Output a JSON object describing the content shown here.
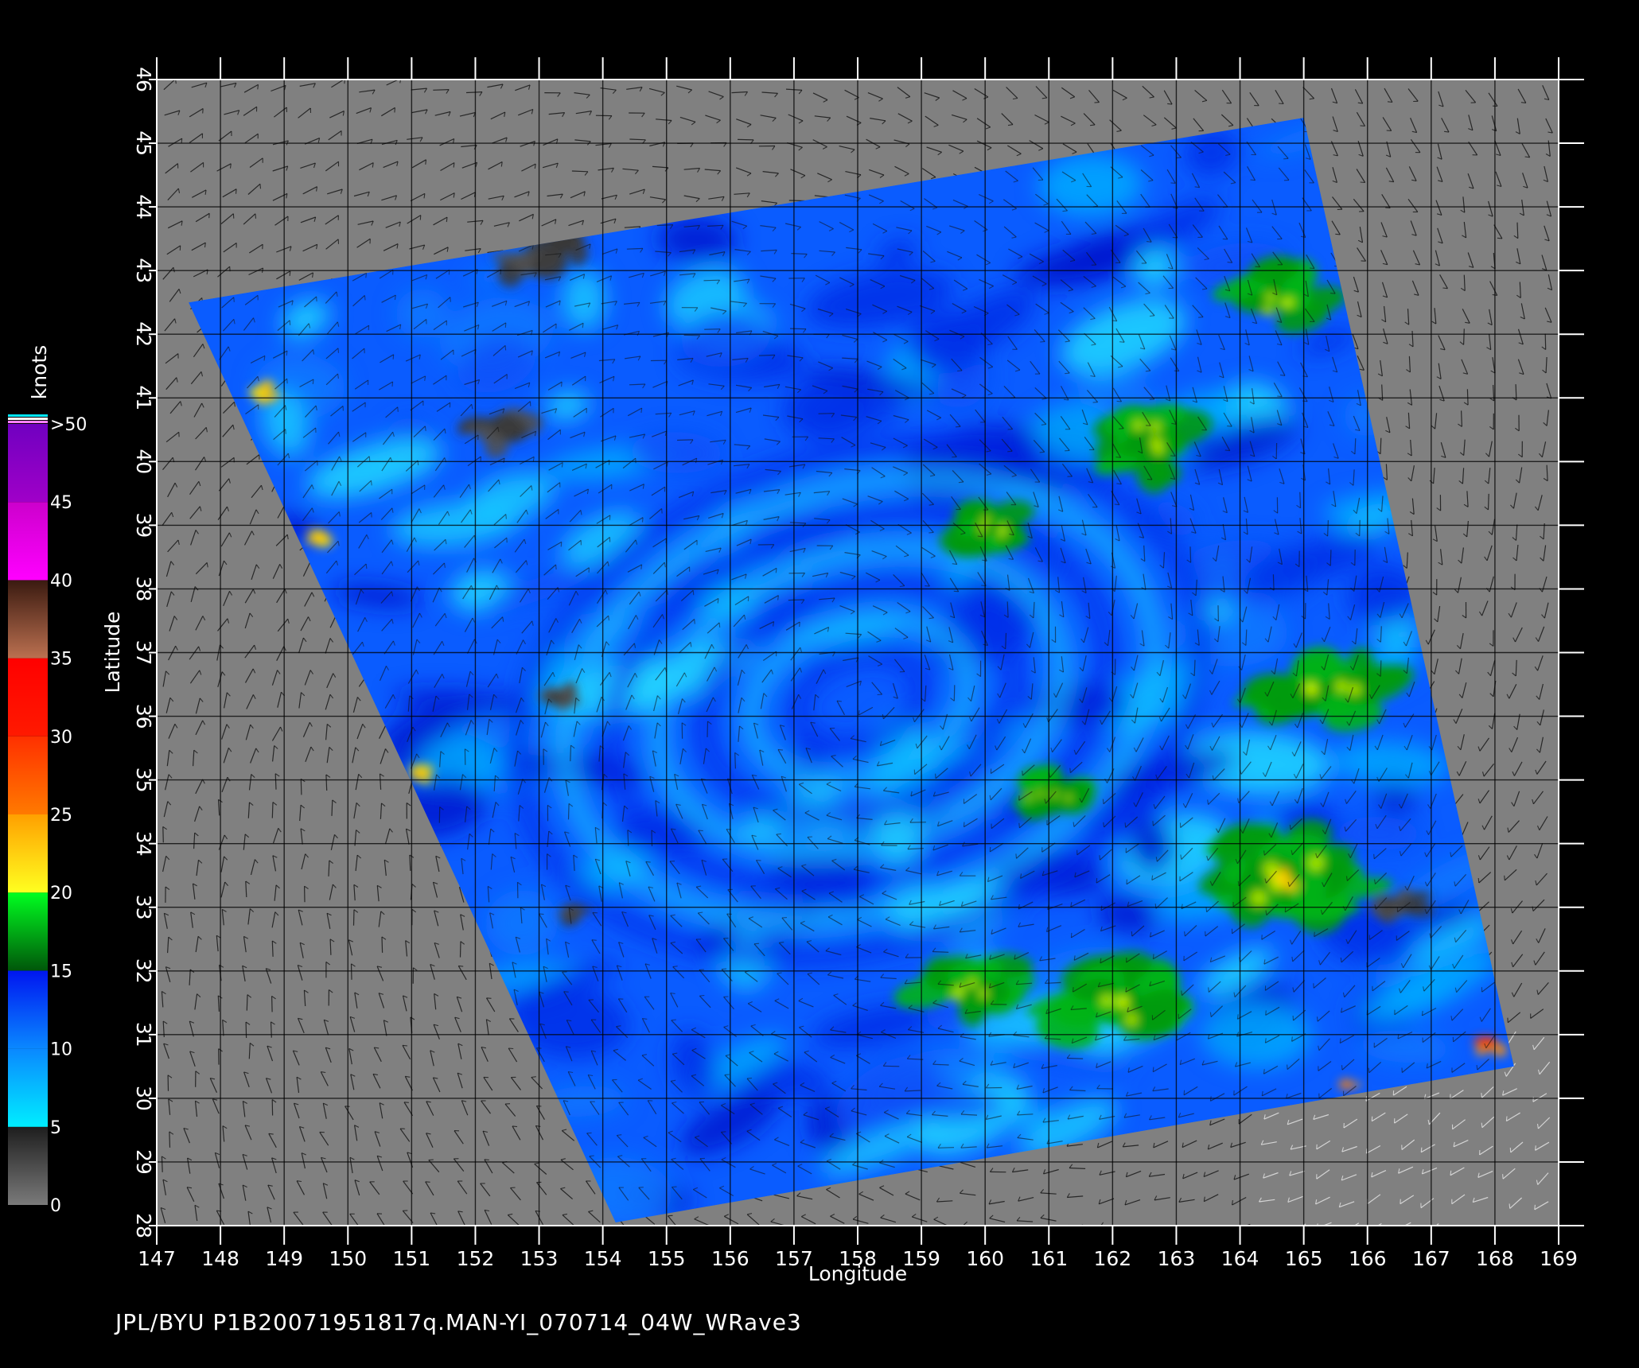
{
  "axes": {
    "xlabel": "Longitude",
    "ylabel": "Latitude",
    "lon_range": [
      147,
      169
    ],
    "lat_range": [
      28,
      46
    ],
    "lon_ticks": [
      "147",
      "148",
      "149",
      "150",
      "151",
      "152",
      "153",
      "154",
      "155",
      "156",
      "157",
      "158",
      "159",
      "160",
      "161",
      "162",
      "163",
      "164",
      "165",
      "166",
      "167",
      "168",
      "169"
    ],
    "lat_ticks": [
      "28",
      "29",
      "30",
      "31",
      "32",
      "33",
      "34",
      "35",
      "36",
      "37",
      "38",
      "39",
      "40",
      "41",
      "42",
      "43",
      "44",
      "45",
      "46"
    ],
    "grid": true
  },
  "colorbar": {
    "unit": "knots",
    "labels": [
      "0",
      "5",
      "10",
      "15",
      "20",
      "25",
      "30",
      "35",
      "40",
      "45",
      ">50"
    ],
    "bands": [
      {
        "from": 0,
        "to": 5,
        "colors": [
          "#7a7a7a",
          "#1e1e1e"
        ]
      },
      {
        "from": 5,
        "to": 10,
        "colors": [
          "#00eeff",
          "#0a88ff"
        ]
      },
      {
        "from": 10,
        "to": 15,
        "colors": [
          "#0a88ff",
          "#0016f0"
        ]
      },
      {
        "from": 15,
        "to": 20,
        "colors": [
          "#00560a",
          "#00ff20"
        ]
      },
      {
        "from": 20,
        "to": 25,
        "colors": [
          "#ffff20",
          "#ffa000"
        ]
      },
      {
        "from": 25,
        "to": 30,
        "colors": [
          "#ff7a00",
          "#ff3000"
        ]
      },
      {
        "from": 30,
        "to": 35,
        "colors": [
          "#ff1a00",
          "#ff0000"
        ]
      },
      {
        "from": 35,
        "to": 40,
        "colors": [
          "#bb7050",
          "#3a1a10"
        ]
      },
      {
        "from": 40,
        "to": 45,
        "colors": [
          "#ff00ff",
          "#cc00cc"
        ]
      },
      {
        "from": 45,
        "to": 50,
        "colors": [
          "#a000c8",
          "#7000c0"
        ]
      }
    ]
  },
  "map": {
    "land_color": "#808080",
    "swath_corners_lonlat": [
      [
        147.5,
        42.5
      ],
      [
        165.0,
        45.4
      ],
      [
        168.3,
        30.5
      ],
      [
        154.2,
        28.05
      ]
    ],
    "wind_regions": [
      {
        "level": "green",
        "lon": 164.6,
        "lat": 42.6,
        "r": 0.9
      },
      {
        "level": "green",
        "lon": 162.5,
        "lat": 40.3,
        "r": 1.1
      },
      {
        "level": "green",
        "lon": 160.0,
        "lat": 39.0,
        "r": 0.8
      },
      {
        "level": "green",
        "lon": 165.3,
        "lat": 36.5,
        "r": 1.2
      },
      {
        "level": "green",
        "lon": 164.5,
        "lat": 33.5,
        "r": 1.6
      },
      {
        "level": "green",
        "lon": 162.0,
        "lat": 31.5,
        "r": 1.3
      },
      {
        "level": "green",
        "lon": 159.8,
        "lat": 31.8,
        "r": 1.0
      },
      {
        "level": "green",
        "lon": 161.0,
        "lat": 34.8,
        "r": 0.7
      },
      {
        "level": "yellow",
        "lon": 148.6,
        "lat": 41.1,
        "r": 0.35
      },
      {
        "level": "yellow",
        "lon": 149.5,
        "lat": 38.8,
        "r": 0.3
      },
      {
        "level": "yellow",
        "lon": 151.2,
        "lat": 35.1,
        "r": 0.3
      },
      {
        "level": "yellow",
        "lon": 164.7,
        "lat": 33.4,
        "r": 0.35
      },
      {
        "level": "red",
        "lon": 168.0,
        "lat": 30.8,
        "r": 0.35
      },
      {
        "level": "red",
        "lon": 165.7,
        "lat": 30.2,
        "r": 0.2
      },
      {
        "level": "rain",
        "lon": 153.0,
        "lat": 43.2,
        "r": 0.8
      },
      {
        "level": "rain",
        "lon": 152.4,
        "lat": 40.5,
        "r": 0.6
      },
      {
        "level": "rain",
        "lon": 153.3,
        "lat": 36.3,
        "r": 0.4
      },
      {
        "level": "rain",
        "lon": 153.5,
        "lat": 32.9,
        "r": 0.3
      },
      {
        "level": "rain",
        "lon": 166.5,
        "lat": 33.0,
        "r": 0.5
      }
    ]
  },
  "footer": {
    "text": "JPL/BYU  P1B20071951817q.MAN-YI_070714_04W_WRave3"
  }
}
